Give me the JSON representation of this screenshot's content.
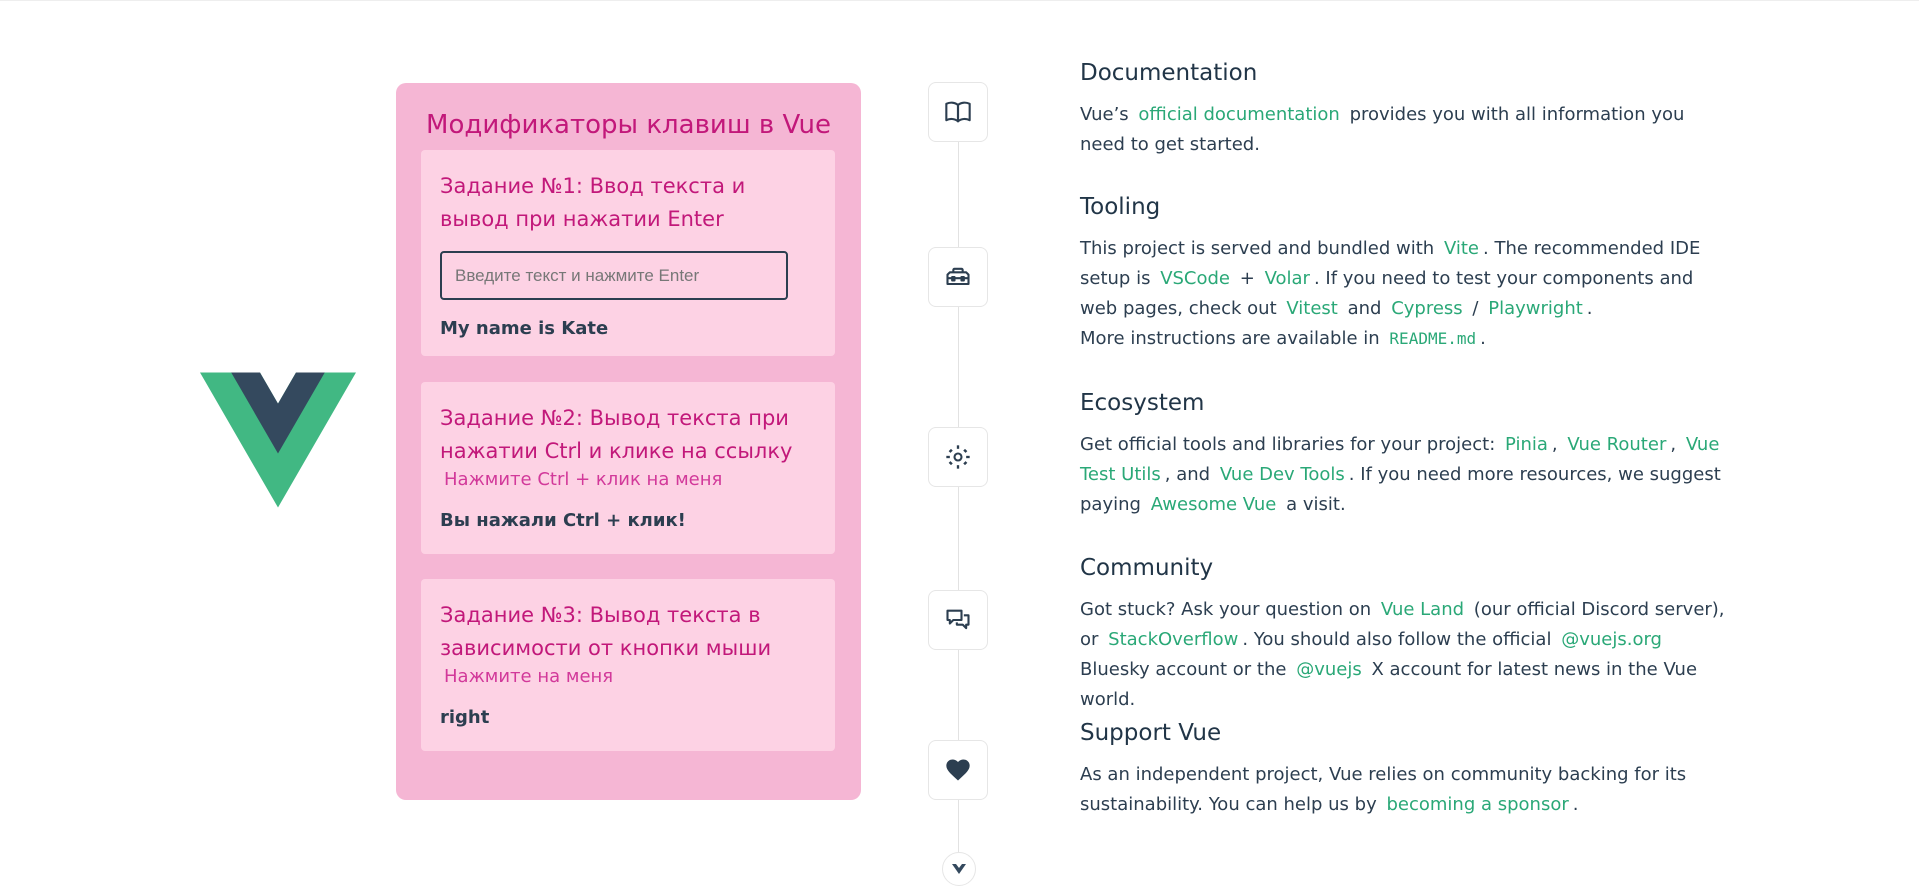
{
  "colors": {
    "vue_green": "#41b883",
    "vue_dark": "#34495e",
    "link": "#2aa877",
    "card_bg": "#f5b6d4",
    "task_bg": "#fdd2e4",
    "accent_text": "#c2187a"
  },
  "logo": {
    "icon": "vue-logo"
  },
  "card": {
    "title": "Модификаторы клавиш в Vue",
    "tasks": [
      {
        "title": "Задание №1: Ввод текста и вывод при нажатии Enter",
        "input_placeholder": "Введите текст и нажмите Enter",
        "input_value": "",
        "result": "My name is Kate"
      },
      {
        "title": "Задание №2: Вывод текста при нажатии Ctrl и клике на ссылку",
        "link": "Нажмите Ctrl + клик на меня",
        "result": "Вы нажали Ctrl + клик!"
      },
      {
        "title": "Задание №3: Вывод текста в зависимости от кнопки мыши",
        "link": "Нажмите на меня",
        "result": "right"
      }
    ]
  },
  "timeline_icons": [
    "book-icon",
    "toolbox-icon",
    "ecosystem-icon",
    "chat-icon",
    "heart-icon",
    "chevron-down-icon"
  ],
  "sections": {
    "documentation": {
      "heading": "Documentation",
      "t1": "Vue’s",
      "link1": "official documentation",
      "t2": "provides you with all information you need to get started."
    },
    "tooling": {
      "heading": "Tooling",
      "t1": "This project is served and bundled with",
      "vite": "Vite",
      "t2": ". The recommended IDE setup is",
      "vscode": "VSCode",
      "plus": "+",
      "volar": "Volar",
      "t3": ". If you need to test your components and web pages, check out",
      "vitest": "Vitest",
      "and": "and",
      "cypress": "Cypress",
      "slash": "/",
      "playwright": "Playwright",
      "dot": ".",
      "t4": "More instructions are available in",
      "readme": "README.md",
      "dot2": "."
    },
    "ecosystem": {
      "heading": "Ecosystem",
      "t1": "Get official tools and libraries for your project:",
      "pinia": "Pinia",
      "comma1": ",",
      "router": "Vue Router",
      "comma2": ",",
      "testutils": "Vue Test Utils",
      "t2": ", and",
      "devtools": "Vue Dev Tools",
      "t3": ". If you need more resources, we suggest paying",
      "awesome": "Awesome Vue",
      "t4": "a visit."
    },
    "community": {
      "heading": "Community",
      "t1": "Got stuck? Ask your question on",
      "vueland": "Vue Land",
      "t2": "(our official Discord server), or",
      "so": "StackOverflow",
      "t3": ". You should also follow the official",
      "bsky": "@vuejs.org",
      "t4": "Bluesky account or the",
      "x": "@vuejs",
      "t5": "X account for latest news in the Vue world."
    },
    "support": {
      "heading": "Support Vue",
      "t1": "As an independent project, Vue relies on community backing for its sustainability. You can help us by",
      "sponsor": "becoming a sponsor",
      "dot": "."
    }
  }
}
